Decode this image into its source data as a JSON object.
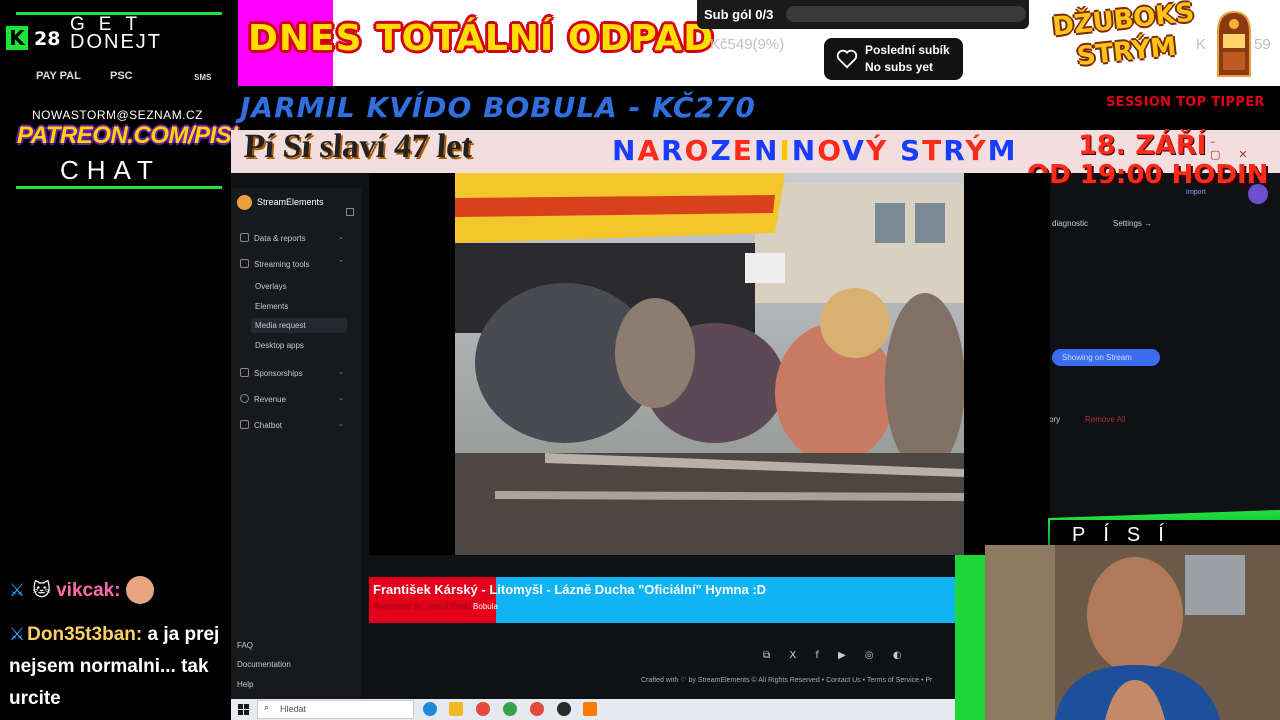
{
  "donate_panel": {
    "count": "28",
    "get_label": "GET",
    "donejt_label": "DONEJT",
    "payment_methods": [
      "PAY PAL",
      "PSC",
      "SMS"
    ],
    "email": "NOWASTORM@SEZNAM.CZ",
    "patreon": "PATREON.COM/PISI",
    "chat_label": "CHAT"
  },
  "banner": {
    "title": "DNES TOTÁLNÍ ODPAD",
    "sub_goal_label": "Sub gól 0/3",
    "sub_goal_progress": 0,
    "money_goal": "Kč549(9%)",
    "last_sub_title": "Poslední subík",
    "last_sub_value": "No subs yet",
    "jukebox_title_line1": "DŽUBOKS",
    "jukebox_title_line2": "STRÝM",
    "jukebox_side_left": "K",
    "jukebox_side_right": "59"
  },
  "top_tipper": {
    "text": "JARMIL KVÍDO BOBULA - KČ270",
    "label": "SESSION TOP TIPPER"
  },
  "birthday": {
    "title": "Pí Sí slaví 47 let",
    "subtitle_letters": [
      "N",
      "A",
      "R",
      "O",
      "Z",
      "E",
      "N",
      "I",
      "N",
      "O",
      "V",
      "Ý",
      " ",
      "S",
      "T",
      "R",
      "Ý",
      "M"
    ],
    "subtitle_colors": [
      "#1a3cff",
      "#ff2a1a",
      "#1a3cff",
      "#ff2a1a",
      "#1a3cff",
      "#ff2a1a",
      "#1a3cff",
      "#ffc400",
      "#1a3cff",
      "#ff2a1a",
      "#1a3cff",
      "#ff2a1a",
      "#1a3cff",
      "#1a3cff",
      "#ff2a1a",
      "#1a3cff",
      "#ff2a1a",
      "#1a3cff"
    ],
    "date": "18. ZÁŘÍ",
    "time": "OD 19:00 HODIN"
  },
  "streamelements": {
    "brand": "StreamElements",
    "nav": [
      {
        "label": "Data & reports",
        "chevron": "⌄"
      },
      {
        "label": "Streaming tools",
        "chevron": "⌃"
      }
    ],
    "sub_items": [
      "Overlays",
      "Elements",
      "Media request",
      "Desktop apps"
    ],
    "nav_bottom": [
      {
        "label": "Sponsorships",
        "chevron": "⌄"
      },
      {
        "label": "Revenue",
        "chevron": "⌄"
      },
      {
        "label": "Chatbot",
        "chevron": "⌄"
      }
    ],
    "side_footer": [
      "FAQ",
      "Documentation",
      "Help"
    ],
    "right_panel": {
      "import": "Import",
      "diagnostic": "diagnostic",
      "settings": "Settings →",
      "showing_on_stream": "Showing on Stream",
      "history": "ory",
      "remove_all": "Remove All"
    },
    "footer": {
      "crafted": "Crafted with ♡ by  StreamElements   © All Rights Reserved  •  Contact Us  •  Terms of Service  •  Pr",
      "social": "⧉ X f ▶ ◎ ◐"
    }
  },
  "now_playing": {
    "title": "František Kárský - Litomyšl - Lázně Ducha \"Oficiální\" Hymna :D",
    "requested_prefix": "Requested by: Jarmil Kvído ",
    "requested_name": "Bobula"
  },
  "taskbar": {
    "search_placeholder": "Hledat"
  },
  "chat": [
    {
      "user": "vikcak:",
      "color": "#ff6aa8",
      "message": ""
    },
    {
      "user": "Don35t3ban:",
      "color": "#ffd066",
      "message": " a ja prej nejsem normalni... tak urcite"
    }
  ],
  "webcam": {
    "label": "PÍSÍ"
  }
}
